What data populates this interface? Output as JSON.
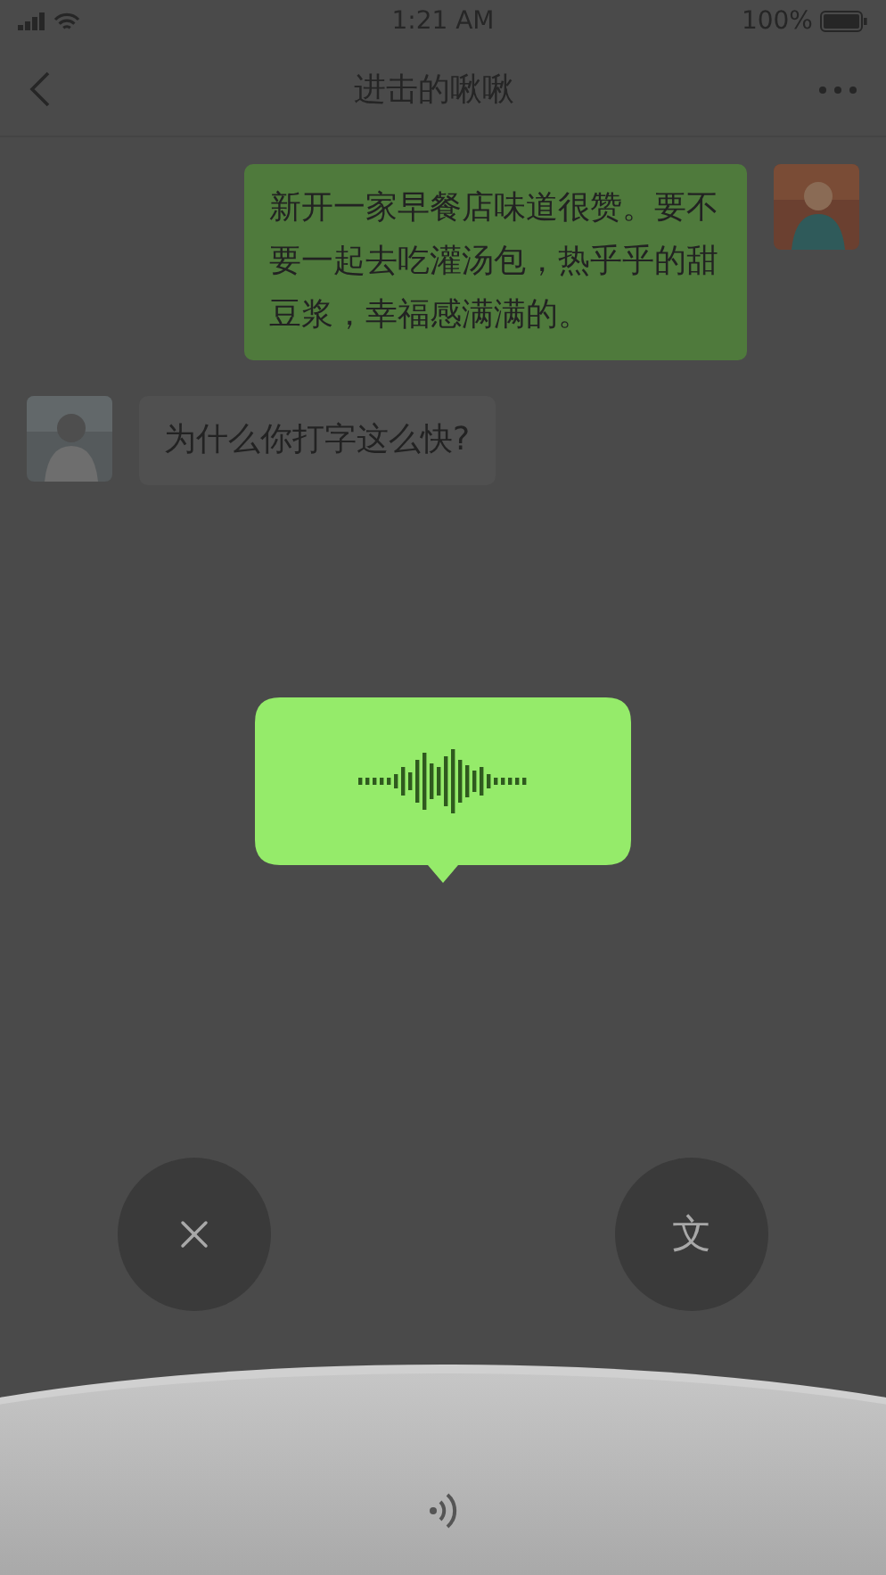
{
  "status_bar": {
    "time": "1:21 AM",
    "battery": "100%"
  },
  "nav": {
    "title": "进击的啾啾"
  },
  "messages": [
    {
      "kind": "sent",
      "text": "新开一家早餐店味道很赞。要不要一起去吃灌汤包，热乎乎的甜豆浆，幸福感满满的。"
    },
    {
      "kind": "received",
      "text": "为什么你打字这么快?"
    }
  ],
  "recording": {
    "kind": "voice"
  },
  "actions": [
    {
      "kind": "cancel"
    },
    {
      "kind": "text",
      "label": "文"
    }
  ]
}
